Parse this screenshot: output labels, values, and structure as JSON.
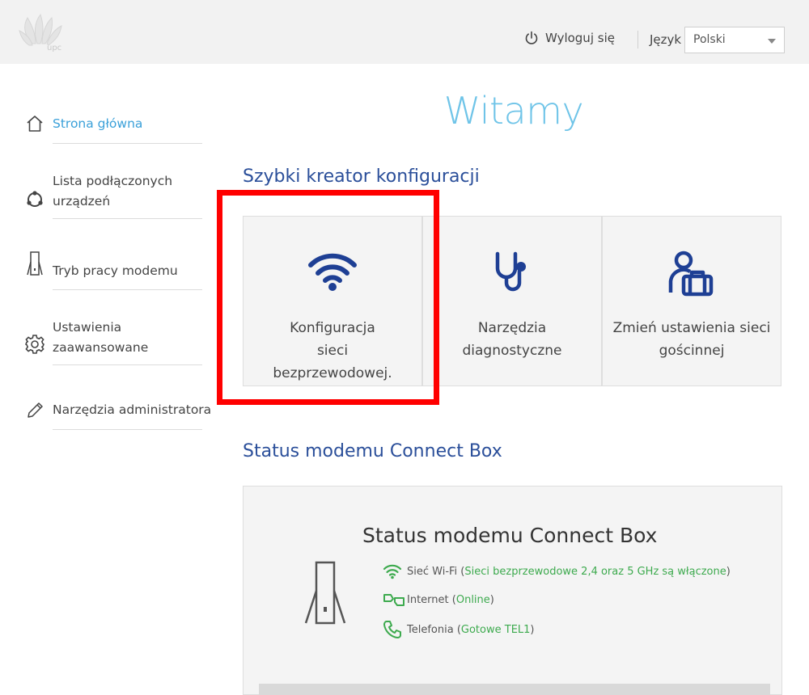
{
  "header": {
    "logo_text": "upc",
    "logout_label": "Wyloguj się",
    "language_label": "Język",
    "language_selected": "Polski"
  },
  "sidebar": {
    "items": [
      {
        "label": "Strona główna",
        "icon": "home-icon",
        "active": true
      },
      {
        "label": "Lista podłączonych urządzeń",
        "icon": "devices-icon"
      },
      {
        "label": "Tryb pracy modemu",
        "icon": "modem-icon"
      },
      {
        "label": "Ustawienia zaawansowane",
        "icon": "gear-icon"
      },
      {
        "label": "Narzędzia administratora",
        "icon": "pencil-icon"
      }
    ]
  },
  "main": {
    "welcome": "Witamy",
    "quick_wizard_title": "Szybki kreator konfiguracji",
    "cards": [
      {
        "label": "Konfiguracja sieci bezprzewodowej.",
        "icon": "wifi-icon"
      },
      {
        "label": "Narzędzia diagnostyczne",
        "icon": "stethoscope-icon"
      },
      {
        "label": "Zmień ustawienia sieci gościnnej",
        "icon": "guest-user-icon"
      }
    ],
    "status_section_title": "Status modemu Connect Box",
    "status": {
      "heading": "Status modemu Connect Box",
      "rows": [
        {
          "name": "Sieć Wi-Fi",
          "value": "Sieci bezprzewodowe 2,4 oraz 5 GHz są włączone ",
          "icon": "wifi-icon"
        },
        {
          "name": "Internet",
          "value": "Online",
          "icon": "internet-icon"
        },
        {
          "name": "Telefonia",
          "value": "Gotowe TEL1",
          "icon": "phone-icon"
        }
      ]
    }
  },
  "colors": {
    "accent": "#3aa0d9",
    "title_blue": "#2b4f9a",
    "icon_navy": "#1e3f94",
    "status_green": "#3daa4e",
    "highlight_red": "#ff0000"
  }
}
